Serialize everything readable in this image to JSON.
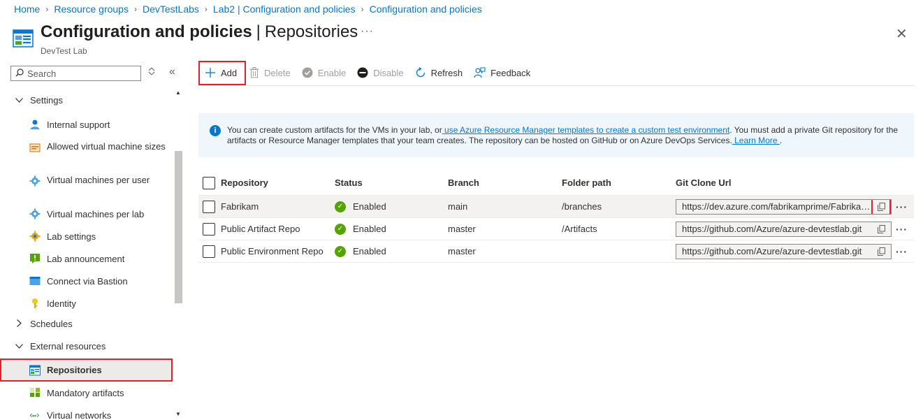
{
  "breadcrumb": [
    "Home",
    "Resource groups",
    "DevTestLabs",
    "Lab2 | Configuration and policies",
    "Configuration and policies"
  ],
  "header": {
    "title": "Configuration and policies",
    "separator": "|",
    "page": "Repositories",
    "subtitle": "DevTest Lab",
    "more": "···",
    "close": "✕"
  },
  "sidebar": {
    "search_placeholder": "Search",
    "groups": {
      "settings": "Settings",
      "schedules": "Schedules",
      "external": "External resources"
    },
    "items": {
      "internal_support": "Internal support",
      "allowed_vm_sizes": "Allowed virtual machine sizes",
      "vms_per_user": "Virtual machines per user",
      "vms_per_lab": "Virtual machines per lab",
      "lab_settings": "Lab settings",
      "lab_announcement": "Lab announcement",
      "connect_bastion": "Connect via Bastion",
      "identity": "Identity",
      "repositories": "Repositories",
      "mandatory_artifacts": "Mandatory artifacts",
      "virtual_networks": "Virtual networks"
    }
  },
  "toolbar": {
    "add": "Add",
    "delete": "Delete",
    "enable": "Enable",
    "disable": "Disable",
    "refresh": "Refresh",
    "feedback": "Feedback"
  },
  "info": {
    "part1": "You can create custom artifacts for the VMs in your lab, or",
    "link1": " use Azure Resource Manager templates to create a custom test environment",
    "part2": ". You must add a private Git repository for the artifacts or Resource Manager templates that your team creates. The repository can be hosted on GitHub or on Azure DevOps Services.",
    "link2": " Learn More ",
    "part3": "."
  },
  "table": {
    "columns": [
      "Repository",
      "Status",
      "Branch",
      "Folder path",
      "Git Clone Url"
    ],
    "rows": [
      {
        "repository": "Fabrikam",
        "status": "Enabled",
        "branch": "main",
        "folder": "/branches",
        "url": "https://dev.azure.com/fabrikamprime/Fabrikam..."
      },
      {
        "repository": "Public Artifact Repo",
        "status": "Enabled",
        "branch": "master",
        "folder": "/Artifacts",
        "url": "https://github.com/Azure/azure-devtestlab.git"
      },
      {
        "repository": "Public Environment Repo",
        "status": "Enabled",
        "branch": "master",
        "folder": "",
        "url": "https://github.com/Azure/azure-devtestlab.git"
      }
    ]
  },
  "colors": {
    "accent": "#0078d4",
    "highlight": "#e3212d",
    "success": "#57a300"
  }
}
